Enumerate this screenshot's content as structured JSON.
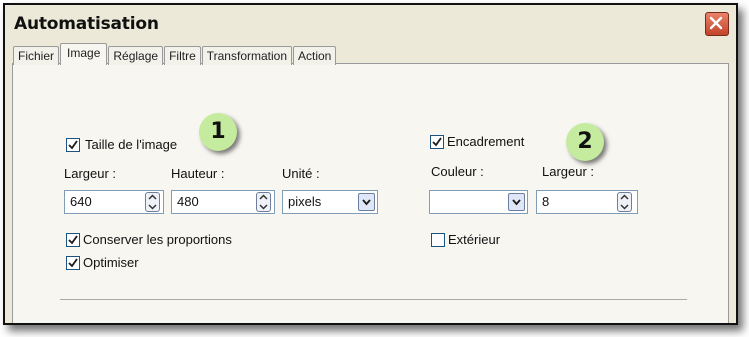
{
  "window": {
    "title": "Automatisation"
  },
  "tabs": [
    {
      "label": "Fichier",
      "active": false
    },
    {
      "label": "Image",
      "active": true
    },
    {
      "label": "Réglage",
      "active": false
    },
    {
      "label": "Filtre",
      "active": false
    },
    {
      "label": "Transformation",
      "active": false
    },
    {
      "label": "Action",
      "active": false
    }
  ],
  "image_size": {
    "checkbox_label": "Taille de l'image",
    "checked": true,
    "width_label": "Largeur :",
    "width_value": "640",
    "height_label": "Hauteur :",
    "height_value": "480",
    "unit_label": "Unité :",
    "unit_value": "pixels",
    "keep_proportions_label": "Conserver les proportions",
    "keep_proportions_checked": true,
    "optimize_label": "Optimiser",
    "optimize_checked": true
  },
  "frame": {
    "checkbox_label": "Encadrement",
    "checked": true,
    "color_label": "Couleur :",
    "width_label": "Largeur :",
    "width_value": "8",
    "exterior_label": "Extérieur",
    "exterior_checked": false
  },
  "annotations": {
    "badge_1": "1",
    "badge_2": "2"
  },
  "colors": {
    "dialog_bg": "#ece9d8",
    "close_button": "#c2432a",
    "badge": "#c4eb9e",
    "checkbox_border": "#1c5180"
  },
  "icons": [
    "close-icon",
    "checkmark-icon",
    "spin-up-icon",
    "spin-down-icon",
    "chevron-down-icon"
  ]
}
